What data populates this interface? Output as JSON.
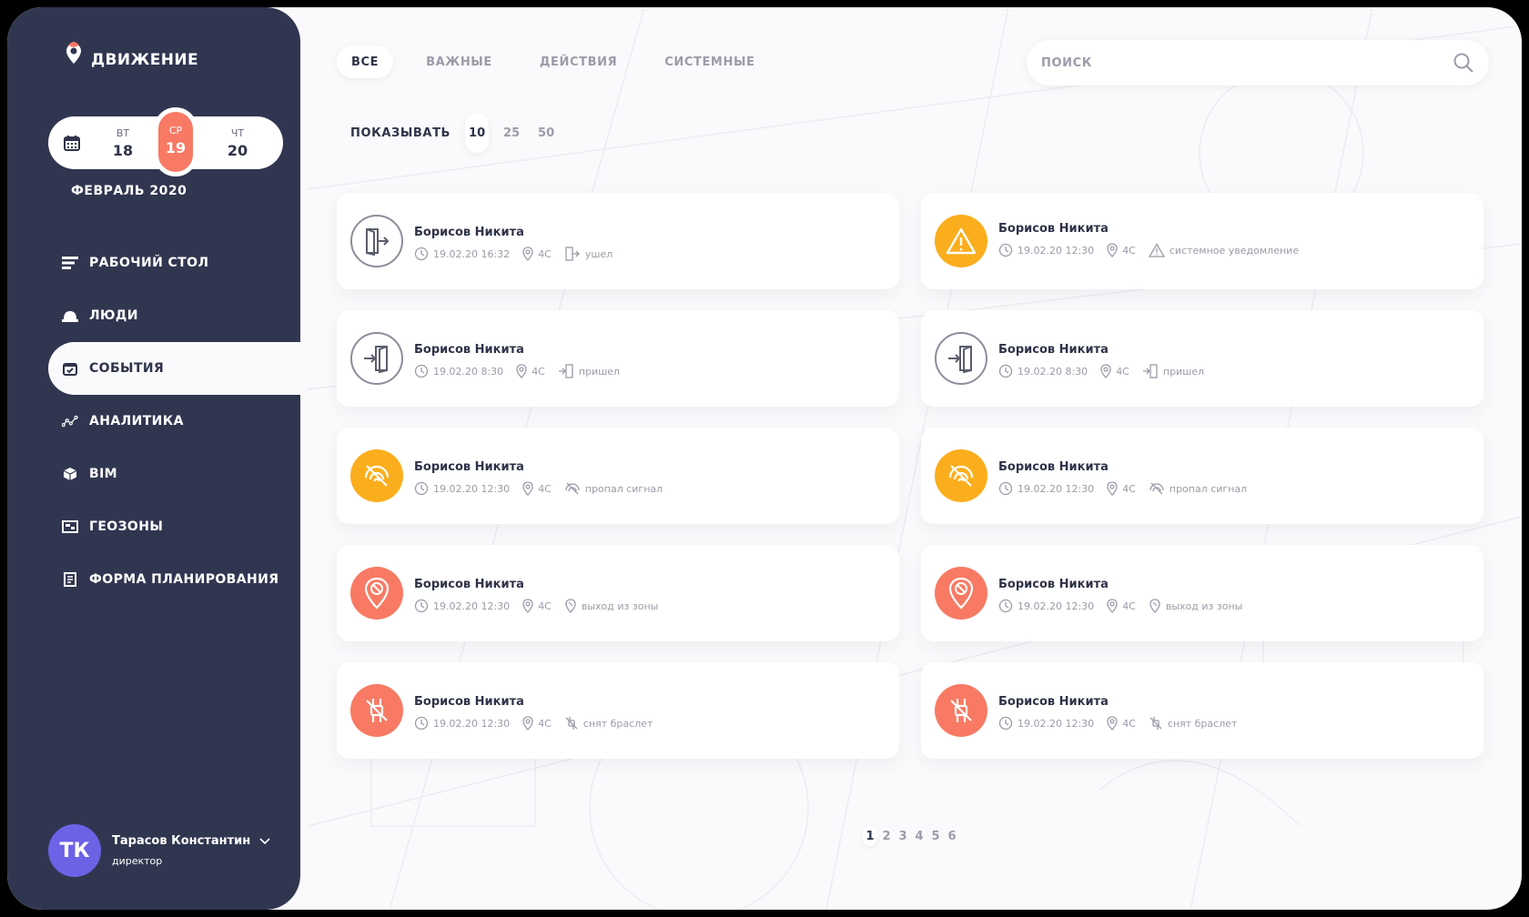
{
  "app": {
    "title": "ДВИЖЕНИЕ"
  },
  "dates": {
    "prev": {
      "dow": "ВТ",
      "num": "18"
    },
    "active": {
      "dow": "СР",
      "num": "19"
    },
    "next": {
      "dow": "ЧТ",
      "num": "20"
    },
    "month": "ФЕВРАЛЬ 2020"
  },
  "nav": [
    {
      "label": "РАБОЧИЙ СТОЛ",
      "icon": "dashboard-icon"
    },
    {
      "label": "ЛЮДИ",
      "icon": "helmet-icon"
    },
    {
      "label": "СОБЫТИЯ",
      "icon": "calendar-check-icon",
      "active": true
    },
    {
      "label": "АНАЛИТИКА",
      "icon": "analytics-icon"
    },
    {
      "label": "BIM",
      "icon": "cube-icon"
    },
    {
      "label": "ГЕОЗОНЫ",
      "icon": "map-icon"
    },
    {
      "label": "ФОРМА ПЛАНИРОВАНИЯ",
      "icon": "form-icon"
    }
  ],
  "user": {
    "initials": "ТК",
    "name": "Тарасов Константин",
    "role": "директор"
  },
  "tabs": [
    {
      "label": "ВСЕ",
      "active": true
    },
    {
      "label": "ВАЖНЫЕ"
    },
    {
      "label": "ДЕЙСТВИЯ"
    },
    {
      "label": "СИСТЕМНЫЕ"
    }
  ],
  "search": {
    "placeholder": "ПОИСК",
    "value": ""
  },
  "show": {
    "label": "ПОКАЗЫВАТЬ",
    "options": [
      "10",
      "25",
      "50"
    ],
    "selected": "10"
  },
  "events": [
    {
      "name": "Борисов Никита",
      "time": "19.02.20 16:32",
      "loc": "4С",
      "status": "ушел",
      "kind": "exit"
    },
    {
      "name": "Борисов Никита",
      "time": "19.02.20 12:30",
      "loc": "4С",
      "status": "системное уведомление",
      "kind": "warning"
    },
    {
      "name": "Борисов Никита",
      "time": "19.02.20 8:30",
      "loc": "4С",
      "status": "пришел",
      "kind": "enter"
    },
    {
      "name": "Борисов Никита",
      "time": "19.02.20 8:30",
      "loc": "4С",
      "status": "пришел",
      "kind": "enter"
    },
    {
      "name": "Борисов Никита",
      "time": "19.02.20 12:30",
      "loc": "4С",
      "status": "пропал сигнал",
      "kind": "signal"
    },
    {
      "name": "Борисов Никита",
      "time": "19.02.20 12:30",
      "loc": "4С",
      "status": "пропал сигнал",
      "kind": "signal"
    },
    {
      "name": "Борисов Никита",
      "time": "19.02.20 12:30",
      "loc": "4С",
      "status": "выход из зоны",
      "kind": "zone"
    },
    {
      "name": "Борисов Никита",
      "time": "19.02.20 12:30",
      "loc": "4С",
      "status": "выход из зоны",
      "kind": "zone"
    },
    {
      "name": "Борисов Никита",
      "time": "19.02.20 12:30",
      "loc": "4С",
      "status": "снят браслет",
      "kind": "bracelet"
    },
    {
      "name": "Борисов Никита",
      "time": "19.02.20 12:30",
      "loc": "4С",
      "status": "снят браслет",
      "kind": "bracelet"
    }
  ],
  "pagination": {
    "pages": [
      "1",
      "2",
      "3",
      "4",
      "5",
      "6"
    ],
    "current": "1"
  },
  "colors": {
    "sidebar": "#313650",
    "accent": "#f87a64",
    "warning": "#fbae1d",
    "avatar": "#6b62e6"
  }
}
